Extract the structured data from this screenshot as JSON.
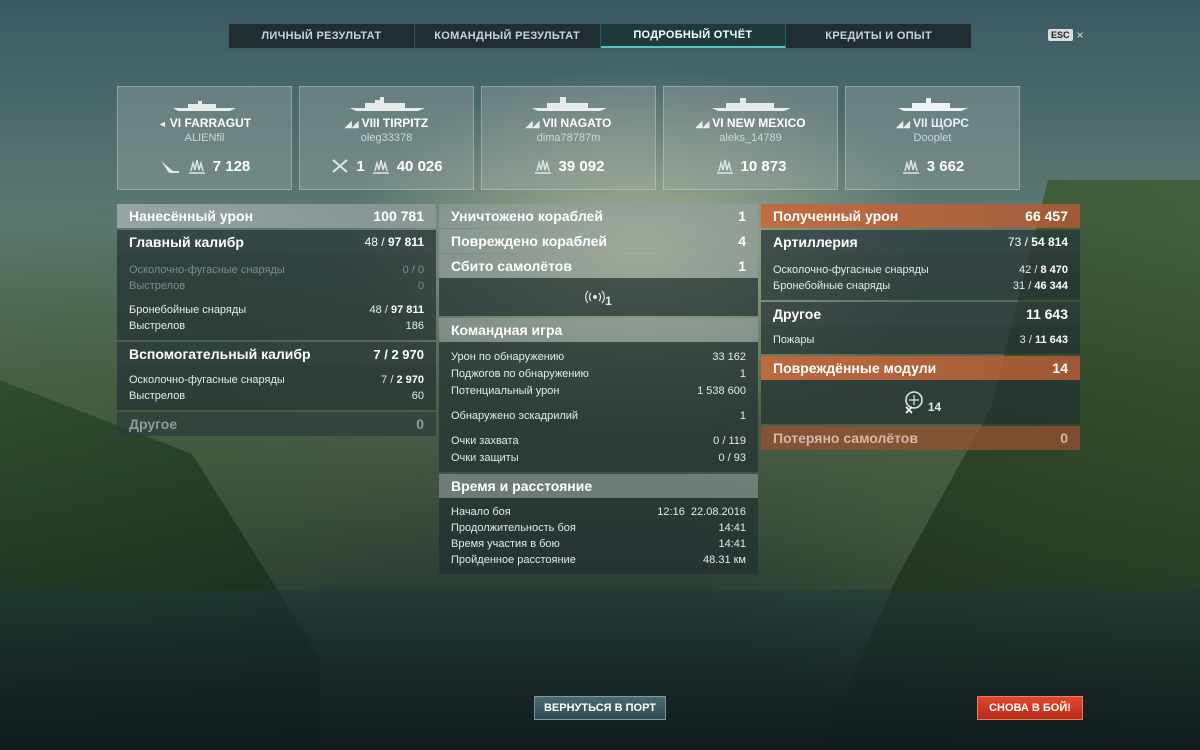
{
  "tabs": [
    {
      "label": "ЛИЧНЫЙ РЕЗУЛЬТАТ",
      "active": false
    },
    {
      "label": "КОМАНДНЫЙ РЕЗУЛЬТАТ",
      "active": false
    },
    {
      "label": "ПОДРОБНЫЙ ОТЧЁТ",
      "active": true
    },
    {
      "label": "КРЕДИТЫ И ОПЫТ",
      "active": false
    }
  ],
  "esc": {
    "key": "ESC",
    "close": "×"
  },
  "ships": [
    {
      "name": "VI FARRAGUT",
      "player": "ALIENfil",
      "torpedo_count": "",
      "kills": "",
      "damage": "7 128",
      "icons": [
        "torpedo-hit-icon",
        "damage-icon"
      ]
    },
    {
      "name": "VIII TIRPITZ",
      "player": "oleg33378",
      "kills": "1",
      "damage": "40 026",
      "icons": [
        "destroyed-icon",
        "damage-icon"
      ]
    },
    {
      "name": "VII NAGATO",
      "player": "dima78787m",
      "kills": "",
      "damage": "39 092",
      "icons": [
        "damage-icon"
      ]
    },
    {
      "name": "VI NEW MEXICO",
      "player": "aleks_14789",
      "kills": "",
      "damage": "10 873",
      "icons": [
        "damage-icon"
      ]
    },
    {
      "name": "VII ЩОРС",
      "player": "Dooplet",
      "kills": "",
      "damage": "3 662",
      "icons": [
        "damage-icon"
      ],
      "own": true
    }
  ],
  "dealt": {
    "title": "Нанесённый урон",
    "total": "100 781",
    "main_battery": {
      "label": "Главный калибр",
      "hits": "48",
      "value": "97 811"
    },
    "mb_he": {
      "label": "Осколочно-фугасные снаряды",
      "value": "0 / 0"
    },
    "mb_he_shots": {
      "label": "Выстрелов",
      "value": "0"
    },
    "mb_ap": {
      "label": "Бронебойные снаряды",
      "hits": "48",
      "value": "97 811"
    },
    "mb_ap_shots": {
      "label": "Выстрелов",
      "value": "186"
    },
    "secondary": {
      "label": "Вспомогательный калибр",
      "hits": "7",
      "value": "2 970"
    },
    "sec_he": {
      "label": "Осколочно-фугасные снаряды",
      "hits": "7",
      "value": "2 970"
    },
    "sec_he_shots": {
      "label": "Выстрелов",
      "value": "60"
    },
    "other": {
      "label": "Другое",
      "value": "0"
    }
  },
  "middle": {
    "destroyed": {
      "label": "Уничтожено кораблей",
      "value": "1"
    },
    "damaged": {
      "label": "Повреждено кораблей",
      "value": "4"
    },
    "planes": {
      "label": "Сбито самолётов",
      "value": "1"
    },
    "spotted_count": "1",
    "team": {
      "title": "Командная игра",
      "rows": [
        {
          "label": "Урон по обнаружению",
          "value": "33 162"
        },
        {
          "label": "Поджогов по обнаружению",
          "value": "1"
        },
        {
          "label": "Потенциальный урон",
          "value": "1 538 600"
        },
        {
          "label": "Обнаружено эскадрилий",
          "value": "1"
        },
        {
          "label": "Очки захвата",
          "value": "0 / 119"
        },
        {
          "label": "Очки защиты",
          "value": "0 / 93"
        }
      ]
    },
    "time": {
      "title": "Время и расстояние",
      "rows": [
        {
          "label": "Начало боя",
          "value": "12:16  22.08.2016"
        },
        {
          "label": "Продолжительность боя",
          "value": "14:41"
        },
        {
          "label": "Время участия в бою",
          "value": "14:41"
        },
        {
          "label": "Пройденное расстояние",
          "value": "48.31 км"
        }
      ]
    }
  },
  "received": {
    "title": "Полученный урон",
    "total": "66 457",
    "artillery": {
      "label": "Артиллерия",
      "hits": "73",
      "value": "54 814"
    },
    "he": {
      "label": "Осколочно-фугасные снаряды",
      "hits": "42",
      "value": "8 470"
    },
    "ap": {
      "label": "Бронебойные снаряды",
      "hits": "31",
      "value": "46 344"
    },
    "other": {
      "label": "Другое",
      "value": "11 643"
    },
    "fires": {
      "label": "Пожары",
      "hits": "3",
      "value": "11 643"
    },
    "modules": {
      "label": "Повреждённые модули",
      "value": "14",
      "icon_count": "14"
    },
    "planes_lost": {
      "label": "Потеряно самолётов",
      "value": "0"
    }
  },
  "buttons": {
    "port": "ВЕРНУТЬСЯ В ПОРТ",
    "battle": "СНОВА В БОЙ!"
  },
  "colors": {
    "accent": "#59c3c3",
    "received": "#c4693c",
    "battle_button": "#e2462d"
  }
}
